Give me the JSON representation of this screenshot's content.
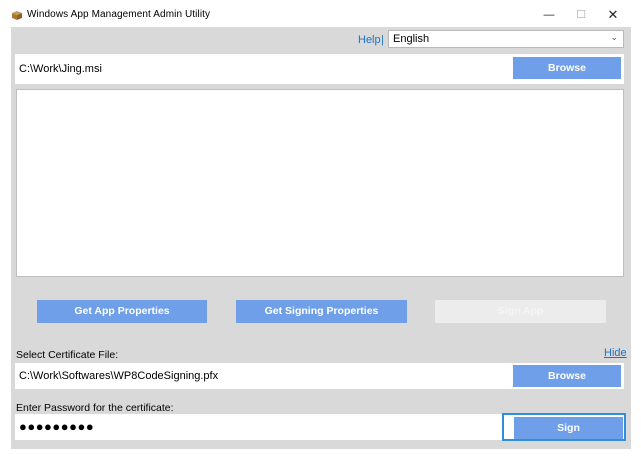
{
  "window": {
    "title": "Windows App Management Admin Utility",
    "icon": "package-icon",
    "controls": {
      "minimize": "—",
      "maximize": "☐",
      "close": "✕"
    }
  },
  "header": {
    "help_label": "Help",
    "separator": "|",
    "language": {
      "selected": "English",
      "chevron": "⌄"
    }
  },
  "package": {
    "path": "C:\\Work\\Jing.msi",
    "browse_label": "Browse"
  },
  "actions": {
    "get_app_properties": "Get App Properties",
    "get_signing_properties": "Get Signing Properties",
    "sign_app": "Sign App",
    "sign_app_enabled": false
  },
  "certificate": {
    "label": "Select Certificate File:",
    "hide_label": "Hide",
    "path": "C:\\Work\\Softwares\\WP8CodeSigning.pfx",
    "browse_label": "Browse"
  },
  "password": {
    "label": "Enter Password for the certificate:",
    "masked_value": "●●●●●●●●●",
    "sign_label": "Sign"
  },
  "colors": {
    "accent": "#6e9fe8",
    "link": "#1e72c9",
    "client_bg": "#d9d9d9",
    "focus_border": "#2f8fd8",
    "disabled_bg": "#ececec"
  }
}
